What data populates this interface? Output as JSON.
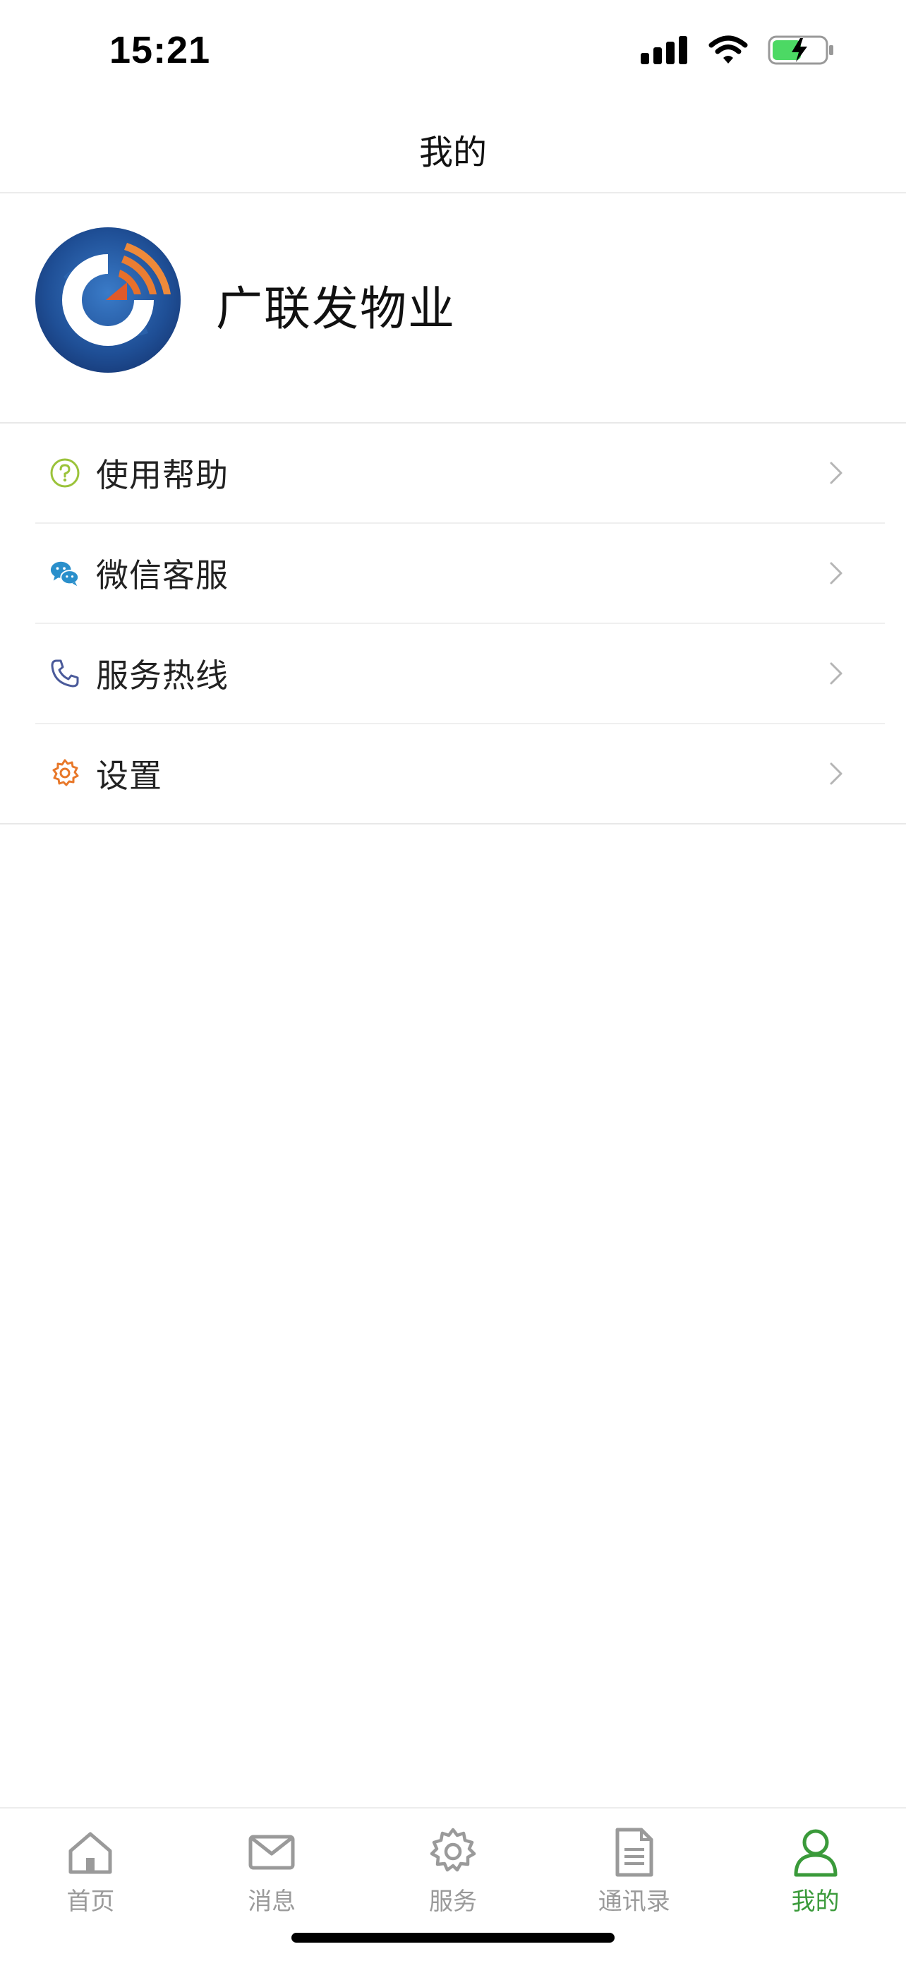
{
  "status_bar": {
    "time": "15:21"
  },
  "header": {
    "title": "我的"
  },
  "profile": {
    "name": "广联发物业"
  },
  "menu": {
    "items": [
      {
        "label": "使用帮助",
        "icon": "help-icon",
        "color": "#9bc33a"
      },
      {
        "label": "微信客服",
        "icon": "wechat-icon",
        "color": "#2a8fcb"
      },
      {
        "label": "服务热线",
        "icon": "phone-icon",
        "color": "#4a5a9a"
      },
      {
        "label": "设置",
        "icon": "settings-icon",
        "color": "#e8782a"
      }
    ]
  },
  "tab_bar": {
    "tabs": [
      {
        "label": "首页",
        "icon": "home-icon",
        "active": false
      },
      {
        "label": "消息",
        "icon": "mail-icon",
        "active": false
      },
      {
        "label": "服务",
        "icon": "gear-icon",
        "active": false
      },
      {
        "label": "通讯录",
        "icon": "document-icon",
        "active": false
      },
      {
        "label": "我的",
        "icon": "user-icon",
        "active": true
      }
    ],
    "active_color": "#3a9a3a",
    "inactive_color": "#9a9a9a"
  }
}
